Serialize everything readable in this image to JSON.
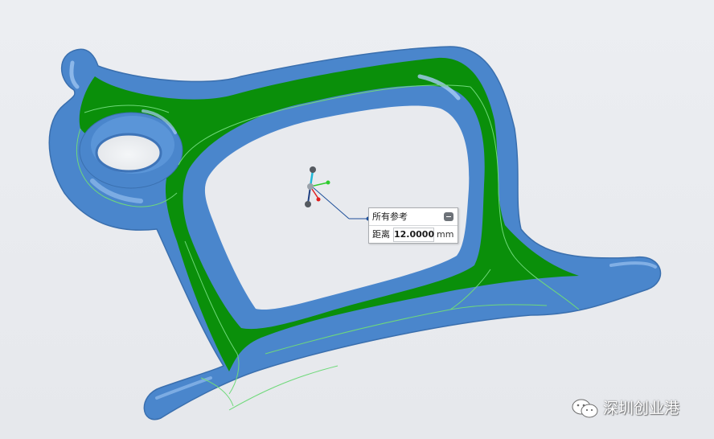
{
  "viewport": {
    "background": "#e9ebef"
  },
  "model": {
    "body_color": "#4a86cc",
    "highlight_color": "#8fbcf0",
    "selected_face_color": "#0a8f0a",
    "edge_color": "#6fd97a"
  },
  "dimension_panel": {
    "title": "所有参考",
    "label": "距离",
    "value": "12.0000",
    "unit": "mm",
    "collapse_icon": "minus-icon"
  },
  "triad": {
    "icon": "coordinate-triad-icon",
    "colors": {
      "x": "#2ecc2e",
      "y": "#20b8d8",
      "z": "#e02020"
    }
  },
  "watermark": {
    "icon": "wechat-icon",
    "text": "深圳创业港"
  }
}
